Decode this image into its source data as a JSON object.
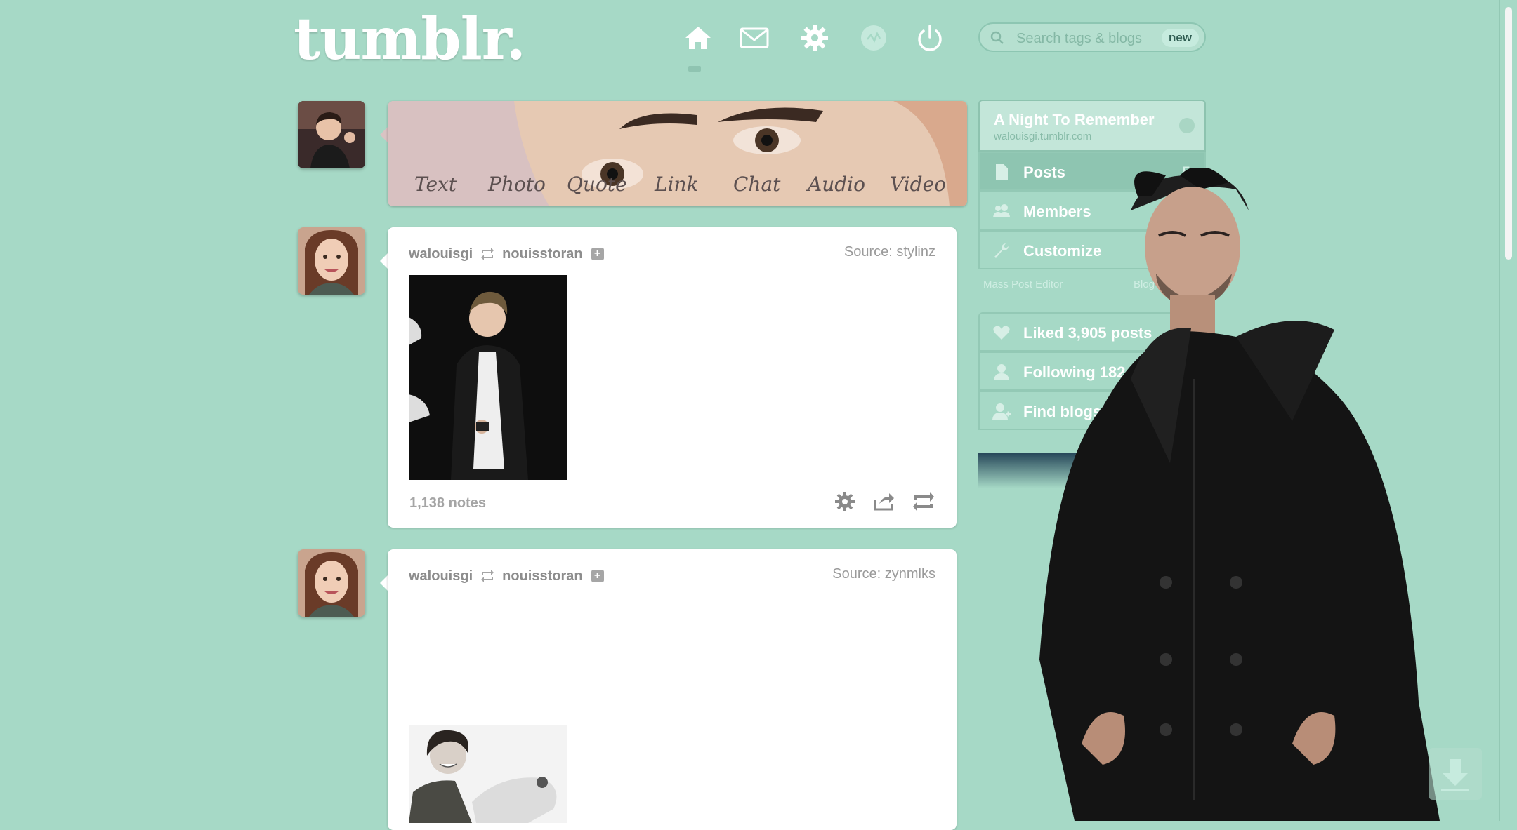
{
  "header": {
    "logo": "tumblr.",
    "nav": [
      "home-icon",
      "mail-icon",
      "gear-icon",
      "activity-icon",
      "power-icon"
    ],
    "search_placeholder": "Search tags & blogs",
    "search_badge": "new"
  },
  "composer": {
    "post_types": [
      "Text",
      "Photo",
      "Quote",
      "Link",
      "Chat",
      "Audio",
      "Video"
    ]
  },
  "posts": [
    {
      "author": "walouisgi",
      "reblogged_from": "nouisstoran",
      "source": "Source: stylinz",
      "notes": "1,138 notes"
    },
    {
      "author": "walouisgi",
      "reblogged_from": "nouisstoran",
      "source": "Source: zynmlks"
    }
  ],
  "sidebar": {
    "blog_title": "A Night To Remember",
    "blog_url": "walouisgi.tumblr.com",
    "items": [
      {
        "label": "Posts",
        "count": "5"
      },
      {
        "label": "Members"
      },
      {
        "label": "Customize"
      }
    ],
    "links": [
      "Mass Post Editor",
      "Blog Setti"
    ],
    "stats": [
      {
        "label": "Liked 3,905 posts"
      },
      {
        "label": "Following 182 blogs"
      },
      {
        "label": "Find blogs"
      }
    ]
  },
  "colors": {
    "background": "#a6d9c6",
    "sidebar_active": "#8ec5b1"
  }
}
